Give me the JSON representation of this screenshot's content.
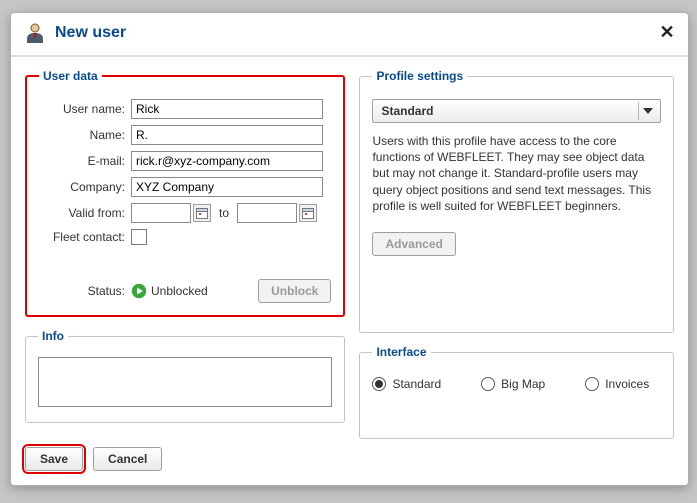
{
  "dialog": {
    "title": "New user",
    "close_label": "✕"
  },
  "user_data": {
    "legend": "User data",
    "labels": {
      "username": "User name:",
      "name": "Name:",
      "email": "E-mail:",
      "company": "Company:",
      "valid_from": "Valid from:",
      "to": "to",
      "fleet_contact": "Fleet contact:",
      "status": "Status:"
    },
    "values": {
      "username": "Rick",
      "name": "R.",
      "email": "rick.r@xyz-company.com",
      "company": "XYZ Company",
      "valid_from": "",
      "valid_to": ""
    },
    "fleet_contact_checked": false,
    "status_text": "Unblocked",
    "unblock_button": "Unblock"
  },
  "profile": {
    "legend": "Profile settings",
    "selected": "Standard",
    "description": "Users with this profile have access to the core functions of WEBFLEET. They may see object data but may not change it. Standard-profile users may query object positions and send text messages. This profile is well suited for WEBFLEET beginners.",
    "advanced_button": "Advanced"
  },
  "info": {
    "legend": "Info",
    "value": ""
  },
  "interface": {
    "legend": "Interface",
    "options": {
      "standard": "Standard",
      "bigmap": "Big Map",
      "invoices": "Invoices"
    },
    "selected": "standard"
  },
  "footer": {
    "save": "Save",
    "cancel": "Cancel"
  }
}
